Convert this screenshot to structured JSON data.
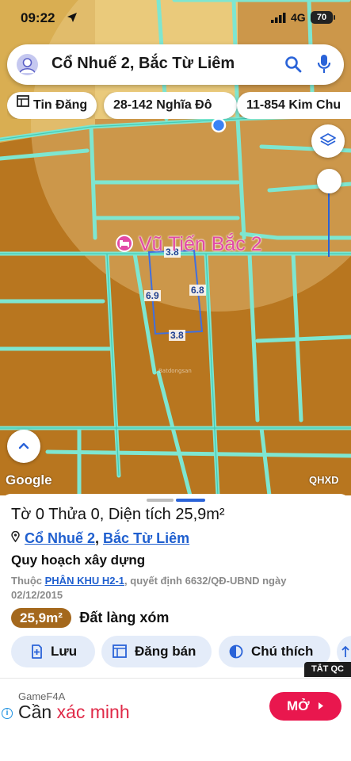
{
  "status_bar": {
    "time": "09:22",
    "network": "4G",
    "battery": "70"
  },
  "search": {
    "query": "Cổ Nhuế 2, Bắc Từ Liêm"
  },
  "chips": [
    {
      "label": "Tin Đăng",
      "icon": "listing-icon"
    },
    {
      "label": "28-142 Nghĩa Đô"
    },
    {
      "label": "11-854 Kim Chu"
    }
  ],
  "map": {
    "poi_label": "Vũ Tiến Bắc 2",
    "dimensions": {
      "top": "3.8",
      "left": "6.9",
      "right": "6.8",
      "bottom": "3.8"
    },
    "google_label": "Google",
    "overlay_code": "QHXD",
    "colors": {
      "land": "#b8761f",
      "road": "#7ee6d0",
      "highlight": "#d9b25c",
      "plot_outline": "#3f6fe0"
    }
  },
  "parcel": {
    "title": "Tờ 0 Thửa 0, Diện tích 25,9m²",
    "ward": "Cổ Nhuế 2",
    "separator": ",",
    "district": "Bắc Từ Liêm",
    "plan_heading": "Quy hoạch xây dựng",
    "plan_prefix": "Thuộc",
    "plan_zone": "PHÂN KHU H2-1",
    "plan_decision": ", quyết định 6632/QĐ-UBND ngày 02/12/2015",
    "area_badge": "25,9m²",
    "land_type": "Đất làng xóm"
  },
  "actions": [
    {
      "label": "Lưu",
      "icon": "save-icon"
    },
    {
      "label": "Đăng bán",
      "icon": "post-sale-icon"
    },
    {
      "label": "Chú thích",
      "icon": "legend-icon"
    }
  ],
  "ad": {
    "tag": "TẮT QC",
    "brand": "GameF4A",
    "headline_plain": "Cần ",
    "headline_highlight": "xác minh",
    "cta": "MỞ"
  }
}
